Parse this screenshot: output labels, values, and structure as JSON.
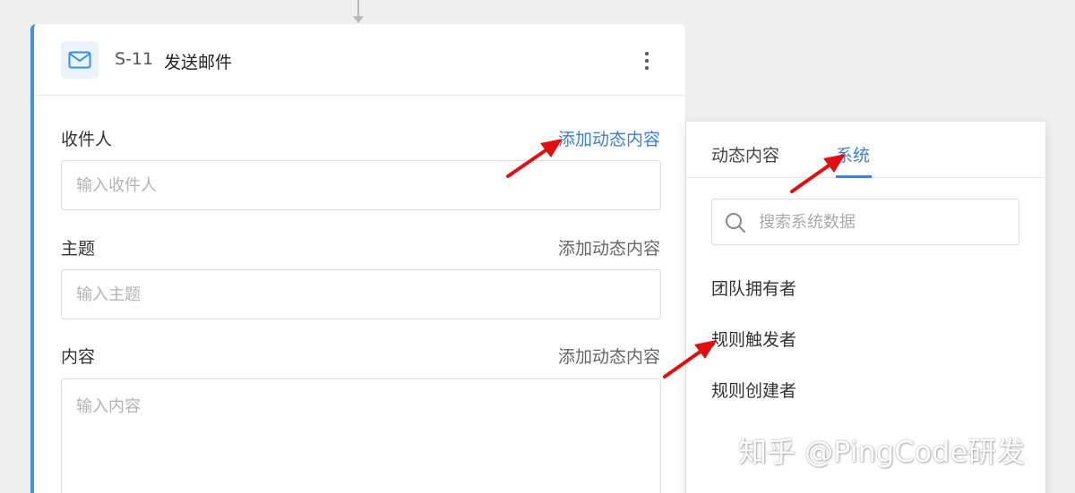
{
  "step": {
    "id": "S-11",
    "title": "发送邮件",
    "icon": "mail-icon",
    "more_icon": "more-vertical-icon"
  },
  "fields": {
    "recipient": {
      "label": "收件人",
      "link": "添加动态内容",
      "placeholder": "输入收件人",
      "value": ""
    },
    "subject": {
      "label": "主题",
      "link": "添加动态内容",
      "placeholder": "输入主题",
      "value": ""
    },
    "content": {
      "label": "内容",
      "link": "添加动态内容",
      "placeholder": "输入内容",
      "value": ""
    }
  },
  "panel": {
    "tabs": [
      {
        "label": "动态内容",
        "active": false
      },
      {
        "label": "系统",
        "active": true
      }
    ],
    "search": {
      "placeholder": "搜索系统数据",
      "icon": "search-icon"
    },
    "items": [
      {
        "label": "团队拥有者"
      },
      {
        "label": "规则触发者"
      },
      {
        "label": "规则创建者"
      }
    ]
  },
  "watermark": "知乎 @PingCode研发",
  "colors": {
    "accent": "#3b7fd4",
    "card_border": "#4a90e2",
    "annotation_arrow": "#e01010",
    "background": "#f0f0f0"
  }
}
